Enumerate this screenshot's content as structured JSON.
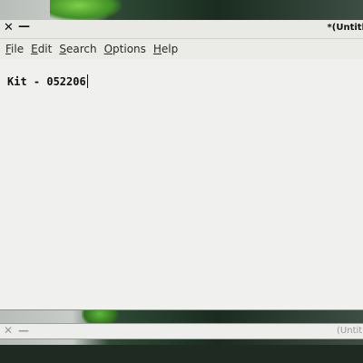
{
  "main_window": {
    "title": "*(Untitl",
    "close_glyph": "✕",
    "minimize_glyph": "—",
    "menu": [
      {
        "pre": "",
        "ul": "F",
        "post": "ile"
      },
      {
        "pre": "",
        "ul": "E",
        "post": "dit"
      },
      {
        "pre": "",
        "ul": "S",
        "post": "earch"
      },
      {
        "pre": "",
        "ul": "O",
        "post": "ptions"
      },
      {
        "pre": "",
        "ul": "H",
        "post": "elp"
      }
    ],
    "editor_text": "Kit - 052206"
  },
  "second_window": {
    "title": "(Untitl",
    "close_glyph": "✕",
    "minimize_glyph": "—"
  }
}
